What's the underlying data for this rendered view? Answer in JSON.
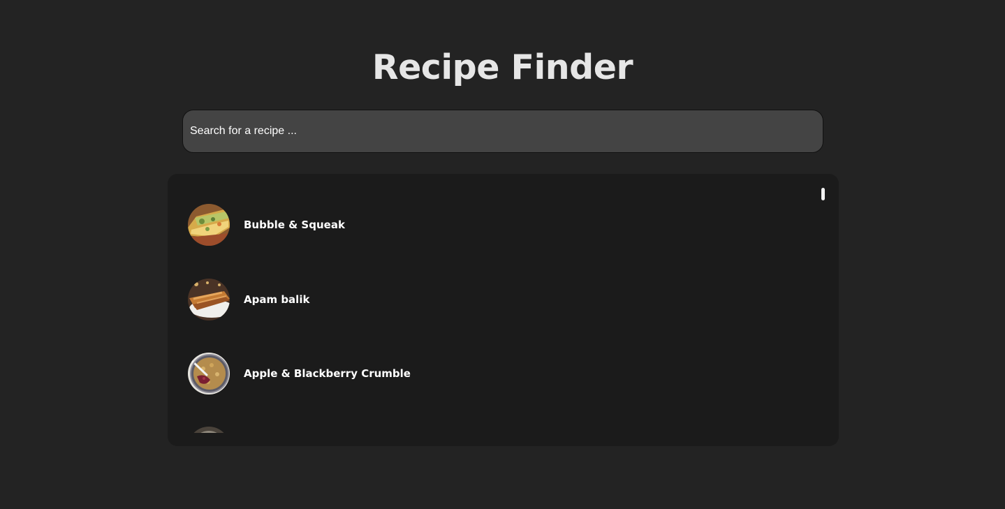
{
  "header": {
    "title": "Recipe Finder"
  },
  "search": {
    "placeholder": "Search for a recipe ...",
    "value": ""
  },
  "results": {
    "items": [
      {
        "name": "Bubble & Squeak",
        "image": "bubble-squeak-photo"
      },
      {
        "name": "Apam balik",
        "image": "apam-balik-photo"
      },
      {
        "name": "Apple & Blackberry Crumble",
        "image": "apple-blackberry-crumble-photo"
      },
      {
        "name": "",
        "image": "partially-visible-recipe-photo"
      }
    ]
  }
}
